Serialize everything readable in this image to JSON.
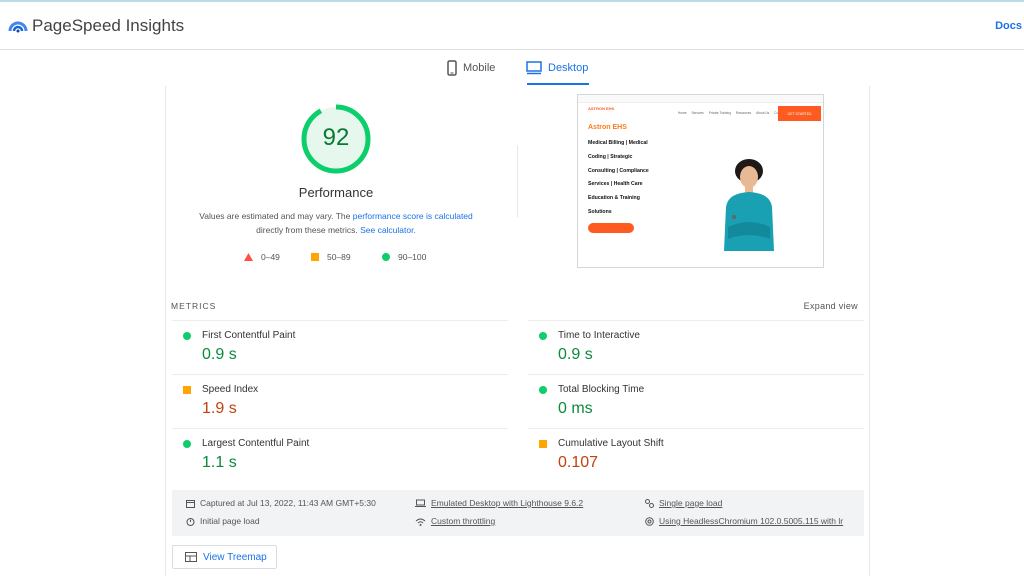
{
  "app": {
    "title": "PageSpeed Insights",
    "docs_label": "Docs"
  },
  "tabs": [
    {
      "label": "Mobile",
      "active": false
    },
    {
      "label": "Desktop",
      "active": true
    }
  ],
  "score": {
    "value": "92",
    "fraction": 0.92,
    "title": "Performance",
    "note_prefix": "Values are estimated and may vary. The ",
    "note_link1": "performance score is calculated",
    "note_mid": " directly from these metrics. ",
    "note_link2": "See calculator."
  },
  "legend": [
    {
      "range": "0–49",
      "shape": "triangle",
      "color": "#ff4e42"
    },
    {
      "range": "50–89",
      "shape": "square",
      "color": "#ffa400"
    },
    {
      "range": "90–100",
      "shape": "circle",
      "color": "#0cce6b"
    }
  ],
  "screenshot": {
    "brand": "ASTRON EHS",
    "heading": "Astron EHS",
    "lines": [
      "Medical Billing | Medical",
      "Coding | Strategic",
      "Consulting | Compliance",
      "Services | Health Care",
      "Education & Training",
      "Solutions"
    ],
    "nav": [
      "Home",
      "Services",
      "Private Training",
      "Resources",
      "About Us",
      "Contact"
    ],
    "cta": "GET STARTED"
  },
  "metrics_section": {
    "label": "METRICS",
    "expand_label": "Expand view"
  },
  "metrics": [
    {
      "name": "First Contentful Paint",
      "value": "0.9 s",
      "status": "good"
    },
    {
      "name": "Time to Interactive",
      "value": "0.9 s",
      "status": "good"
    },
    {
      "name": "Speed Index",
      "value": "1.9 s",
      "status": "average"
    },
    {
      "name": "Total Blocking Time",
      "value": "0 ms",
      "status": "good"
    },
    {
      "name": "Largest Contentful Paint",
      "value": "1.1 s",
      "status": "good"
    },
    {
      "name": "Cumulative Layout Shift",
      "value": "0.107",
      "status": "average"
    }
  ],
  "runtime": {
    "captured": "Captured at Jul 13, 2022, 11:43 AM GMT+5:30",
    "emulated": "Emulated Desktop with Lighthouse 9.6.2",
    "single_page": "Single page load",
    "initial_load": "Initial page load",
    "throttling": "Custom throttling",
    "browser": "Using HeadlessChromium 102.0.5005.115 with lr"
  },
  "treemap_label": "View Treemap",
  "colors": {
    "accent": "#1a73e8",
    "good": "#0cce6b",
    "average": "#ffa400",
    "poor": "#ff4e42"
  }
}
